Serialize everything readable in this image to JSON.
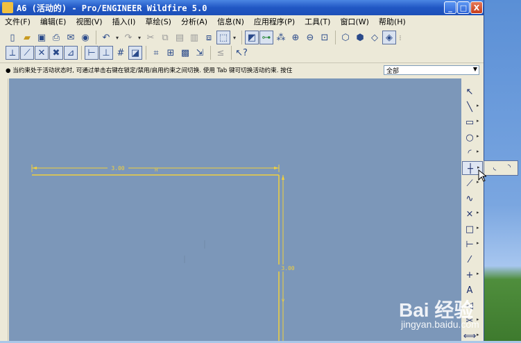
{
  "window": {
    "title": "A6 (活动的) - Pro/ENGINEER Wildfire 5.0",
    "controls": {
      "minimize": "_",
      "maximize": "□",
      "close": "X"
    }
  },
  "menu": [
    {
      "label": "文件(F)"
    },
    {
      "label": "编辑(E)"
    },
    {
      "label": "视图(V)"
    },
    {
      "label": "插入(I)"
    },
    {
      "label": "草绘(S)"
    },
    {
      "label": "分析(A)"
    },
    {
      "label": "信息(N)"
    },
    {
      "label": "应用程序(P)"
    },
    {
      "label": "工具(T)"
    },
    {
      "label": "窗口(W)"
    },
    {
      "label": "帮助(H)"
    }
  ],
  "toolbar1": {
    "icons": [
      "new-file-icon",
      "open-folder-icon",
      "save-icon",
      "print-icon",
      "email-icon",
      "save-a-copy-icon",
      "undo-icon",
      "redo-icon",
      "cut-icon",
      "copy-icon",
      "paste-icon",
      "paste-special-icon",
      "regenerate-icon",
      "selection-box-icon",
      "sketch-orientation-icon",
      "sketch-display-icon",
      "datum-display-icon",
      "zoom-in-icon",
      "zoom-out-icon",
      "zoom-fit-icon",
      "wireframe-icon",
      "hidden-line-icon",
      "no-hidden-icon",
      "shading-icon",
      "view-options-icon"
    ]
  },
  "toolbar2": {
    "icons": [
      "orient-icon",
      "datum-planes-icon",
      "datum-axes-icon",
      "datum-points-icon",
      "coordinate-system-icon",
      "dimension-display-icon",
      "constraint-display-icon",
      "grid-display-icon",
      "vertex-display-icon",
      "sketcher-diagnostics-icon",
      "overlap-icon",
      "shade-closed-loops-icon",
      "highlight-open-ends-icon",
      "feature-requirements-icon",
      "context-help-icon"
    ]
  },
  "status": {
    "message": "● 当约束处于活动状态时, 可通过单击右键在锁定/禁用/启用约束之间切换. 使用 Tab 键可切换活动约束. 按住",
    "filter_value": "全部"
  },
  "sketch": {
    "horizontal_dim": "3.00",
    "horizontal_constraint": "H",
    "vertical_dim": "3.00",
    "vertical_constraint": "V",
    "line_color": "#f2d13c",
    "canvas_color": "#7c97b9"
  },
  "sketch_tools": [
    {
      "icon": "select-arrow-icon",
      "glyph": "↖",
      "flyout": false
    },
    {
      "icon": "line-icon",
      "glyph": "╲",
      "flyout": true
    },
    {
      "icon": "rectangle-icon",
      "glyph": "▭",
      "flyout": true
    },
    {
      "icon": "circle-icon",
      "glyph": "○",
      "flyout": true
    },
    {
      "icon": "arc-icon",
      "glyph": "◜",
      "flyout": true
    },
    {
      "icon": "fillet-icon",
      "glyph": "┼",
      "flyout": true,
      "active": true
    },
    {
      "icon": "chamfer-icon",
      "glyph": "⟋",
      "flyout": true
    },
    {
      "icon": "spline-icon",
      "glyph": "∿",
      "flyout": false
    },
    {
      "icon": "point-icon",
      "glyph": "×",
      "flyout": true
    },
    {
      "icon": "use-edge-icon",
      "glyph": "□",
      "flyout": true
    },
    {
      "icon": "dimension-icon",
      "glyph": "⊢",
      "flyout": true
    },
    {
      "icon": "modify-icon",
      "glyph": "⁄",
      "flyout": false
    },
    {
      "icon": "constraint-icon",
      "glyph": "+",
      "flyout": true
    },
    {
      "icon": "text-icon",
      "glyph": "A",
      "flyout": false
    },
    {
      "icon": "palette-icon",
      "glyph": "◁",
      "flyout": false
    },
    {
      "icon": "trim-icon",
      "glyph": "✂",
      "flyout": true
    },
    {
      "icon": "mirror-icon",
      "glyph": "⟺",
      "flyout": true
    }
  ],
  "flyout": [
    {
      "icon": "circular-fillet-icon",
      "glyph": "◟"
    },
    {
      "icon": "elliptical-fillet-icon",
      "glyph": "◝"
    }
  ],
  "watermark": {
    "logo": "Bai 经验",
    "url": "jingyan.baidu.com"
  }
}
